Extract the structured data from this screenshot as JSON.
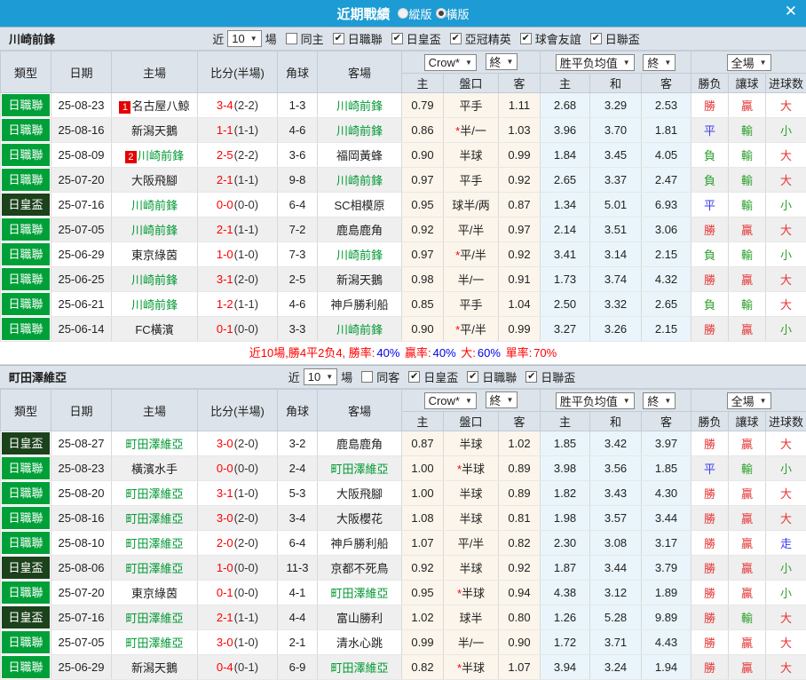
{
  "header": {
    "title": "近期戰績",
    "views": [
      {
        "label": "縱版",
        "selected": false
      },
      {
        "label": "橫版",
        "selected": true
      }
    ]
  },
  "icons": {
    "chevron": "▼",
    "check": "✔",
    "close": "✕"
  },
  "columns": {
    "type": "類型",
    "date": "日期",
    "home": "主場",
    "score": "比分(半場)",
    "corner": "角球",
    "away": "客場",
    "odds_select": "Crow*",
    "odds_final": "終",
    "odds_sub": [
      "主",
      "盤口",
      "客"
    ],
    "avg_select": "胜平负均值",
    "avg_final": "終",
    "avg_sub": [
      "主",
      "和",
      "客"
    ],
    "full_select": "全場",
    "full_sub": [
      "勝负",
      "讓球",
      "进球数"
    ]
  },
  "colors": {
    "topbar": "#1D9BD4",
    "type_badge": {
      "日職聯": "#00A039",
      "日皇盃": "#1C421C"
    },
    "focus_team": "#009933",
    "score_ft": "#FF0000",
    "summary_red": "#FF0000",
    "summary_blue": "#0000EE",
    "result": {
      "勝": "#E53535",
      "贏": "#E53535",
      "大": "#E53535",
      "平": "#3B3BF0",
      "走": "#3B3BF0",
      "負": "#2DA02D",
      "輸": "#2DA02D",
      "小": "#2DA02D"
    }
  },
  "sections": [
    {
      "team": "川崎前鋒",
      "filter": {
        "near": "近",
        "games": "10",
        "unit": "場",
        "options": [
          {
            "label": "同主",
            "checked": false
          },
          {
            "label": "日職聯",
            "checked": true
          },
          {
            "label": "日皇盃",
            "checked": true
          },
          {
            "label": "亞冠精英",
            "checked": true
          },
          {
            "label": "球會友誼",
            "checked": true
          },
          {
            "label": "日聯盃",
            "checked": true
          }
        ]
      },
      "rows": [
        {
          "type": "日職聯",
          "date": "25-08-23",
          "home": "名古屋八鯨",
          "home_badge": "1",
          "home_focus": false,
          "ft": "3-4",
          "ht": "(2-2)",
          "corner": "1-3",
          "away": "川崎前鋒",
          "away_focus": true,
          "odds": [
            "0.79",
            "平手",
            "1.11"
          ],
          "avg": [
            "2.68",
            "3.29",
            "2.53"
          ],
          "full": [
            "勝",
            "贏",
            "大"
          ]
        },
        {
          "type": "日職聯",
          "date": "25-08-16",
          "home": "新潟天鵝",
          "home_focus": false,
          "ft": "1-1",
          "ht": "(1-1)",
          "corner": "4-6",
          "away": "川崎前鋒",
          "away_focus": true,
          "odds": [
            "0.86",
            "*半/一",
            "1.03"
          ],
          "avg": [
            "3.96",
            "3.70",
            "1.81"
          ],
          "full": [
            "平",
            "輸",
            "小"
          ]
        },
        {
          "type": "日職聯",
          "date": "25-08-09",
          "home": "川崎前鋒",
          "home_badge": "2",
          "home_focus": true,
          "ft": "2-5",
          "ht": "(2-2)",
          "corner": "3-6",
          "away": "福岡黃蜂",
          "away_focus": false,
          "odds": [
            "0.90",
            "半球",
            "0.99"
          ],
          "avg": [
            "1.84",
            "3.45",
            "4.05"
          ],
          "full": [
            "負",
            "輸",
            "大"
          ]
        },
        {
          "type": "日職聯",
          "date": "25-07-20",
          "home": "大阪飛腳",
          "home_focus": false,
          "ft": "2-1",
          "ht": "(1-1)",
          "corner": "9-8",
          "away": "川崎前鋒",
          "away_focus": true,
          "odds": [
            "0.97",
            "平手",
            "0.92"
          ],
          "avg": [
            "2.65",
            "3.37",
            "2.47"
          ],
          "full": [
            "負",
            "輸",
            "大"
          ]
        },
        {
          "type": "日皇盃",
          "date": "25-07-16",
          "home": "川崎前鋒",
          "home_focus": true,
          "ft": "0-0",
          "ht": "(0-0)",
          "corner": "6-4",
          "away": "SC相模原",
          "away_focus": false,
          "odds": [
            "0.95",
            "球半/两",
            "0.87"
          ],
          "avg": [
            "1.34",
            "5.01",
            "6.93"
          ],
          "full": [
            "平",
            "輸",
            "小"
          ]
        },
        {
          "type": "日職聯",
          "date": "25-07-05",
          "home": "川崎前鋒",
          "home_focus": true,
          "ft": "2-1",
          "ht": "(1-1)",
          "corner": "7-2",
          "away": "鹿島鹿角",
          "away_focus": false,
          "odds": [
            "0.92",
            "平/半",
            "0.97"
          ],
          "avg": [
            "2.14",
            "3.51",
            "3.06"
          ],
          "full": [
            "勝",
            "贏",
            "大"
          ]
        },
        {
          "type": "日職聯",
          "date": "25-06-29",
          "home": "東京綠茵",
          "home_focus": false,
          "ft": "1-0",
          "ht": "(1-0)",
          "corner": "7-3",
          "away": "川崎前鋒",
          "away_focus": true,
          "odds": [
            "0.97",
            "*平/半",
            "0.92"
          ],
          "avg": [
            "3.41",
            "3.14",
            "2.15"
          ],
          "full": [
            "負",
            "輸",
            "小"
          ]
        },
        {
          "type": "日職聯",
          "date": "25-06-25",
          "home": "川崎前鋒",
          "home_focus": true,
          "ft": "3-1",
          "ht": "(2-0)",
          "corner": "2-5",
          "away": "新潟天鵝",
          "away_focus": false,
          "odds": [
            "0.98",
            "半/一",
            "0.91"
          ],
          "avg": [
            "1.73",
            "3.74",
            "4.32"
          ],
          "full": [
            "勝",
            "贏",
            "大"
          ]
        },
        {
          "type": "日職聯",
          "date": "25-06-21",
          "home": "川崎前鋒",
          "home_focus": true,
          "ft": "1-2",
          "ht": "(1-1)",
          "corner": "4-6",
          "away": "神戶勝利船",
          "away_focus": false,
          "odds": [
            "0.85",
            "平手",
            "1.04"
          ],
          "avg": [
            "2.50",
            "3.32",
            "2.65"
          ],
          "full": [
            "負",
            "輸",
            "大"
          ]
        },
        {
          "type": "日職聯",
          "date": "25-06-14",
          "home": "FC橫濱",
          "home_focus": false,
          "ft": "0-1",
          "ht": "(0-0)",
          "corner": "3-3",
          "away": "川崎前鋒",
          "away_focus": true,
          "odds": [
            "0.90",
            "*平/半",
            "0.99"
          ],
          "avg": [
            "3.27",
            "3.26",
            "2.15"
          ],
          "full": [
            "勝",
            "贏",
            "小"
          ]
        }
      ],
      "summary": [
        {
          "t": "近10場,勝4平2负4, 勝率:",
          "c": "red"
        },
        {
          "t": "40%",
          "c": "blue"
        },
        {
          "t": " 贏率:",
          "c": "red"
        },
        {
          "t": "40%",
          "c": "blue"
        },
        {
          "t": " 大:",
          "c": "red"
        },
        {
          "t": "60%",
          "c": "blue"
        },
        {
          "t": " 單率:",
          "c": "red"
        },
        {
          "t": "70%",
          "c": "red"
        }
      ]
    },
    {
      "team": "町田澤維亞",
      "filter": {
        "near": "近",
        "games": "10",
        "unit": "場",
        "options": [
          {
            "label": "同客",
            "checked": false
          },
          {
            "label": "日皇盃",
            "checked": true
          },
          {
            "label": "日職聯",
            "checked": true
          },
          {
            "label": "日聯盃",
            "checked": true
          }
        ]
      },
      "rows": [
        {
          "type": "日皇盃",
          "date": "25-08-27",
          "home": "町田澤維亞",
          "home_focus": true,
          "ft": "3-0",
          "ht": "(2-0)",
          "corner": "3-2",
          "away": "鹿島鹿角",
          "away_focus": false,
          "odds": [
            "0.87",
            "半球",
            "1.02"
          ],
          "avg": [
            "1.85",
            "3.42",
            "3.97"
          ],
          "full": [
            "勝",
            "贏",
            "大"
          ]
        },
        {
          "type": "日職聯",
          "date": "25-08-23",
          "home": "橫濱水手",
          "home_focus": false,
          "ft": "0-0",
          "ht": "(0-0)",
          "corner": "2-4",
          "away": "町田澤維亞",
          "away_focus": true,
          "odds": [
            "1.00",
            "*半球",
            "0.89"
          ],
          "avg": [
            "3.98",
            "3.56",
            "1.85"
          ],
          "full": [
            "平",
            "輸",
            "小"
          ]
        },
        {
          "type": "日職聯",
          "date": "25-08-20",
          "home": "町田澤維亞",
          "home_focus": true,
          "ft": "3-1",
          "ht": "(1-0)",
          "corner": "5-3",
          "away": "大阪飛腳",
          "away_focus": false,
          "odds": [
            "1.00",
            "半球",
            "0.89"
          ],
          "avg": [
            "1.82",
            "3.43",
            "4.30"
          ],
          "full": [
            "勝",
            "贏",
            "大"
          ]
        },
        {
          "type": "日職聯",
          "date": "25-08-16",
          "home": "町田澤維亞",
          "home_focus": true,
          "ft": "3-0",
          "ht": "(2-0)",
          "corner": "3-4",
          "away": "大阪櫻花",
          "away_focus": false,
          "odds": [
            "1.08",
            "半球",
            "0.81"
          ],
          "avg": [
            "1.98",
            "3.57",
            "3.44"
          ],
          "full": [
            "勝",
            "贏",
            "大"
          ]
        },
        {
          "type": "日職聯",
          "date": "25-08-10",
          "home": "町田澤維亞",
          "home_focus": true,
          "ft": "2-0",
          "ht": "(2-0)",
          "corner": "6-4",
          "away": "神戶勝利船",
          "away_focus": false,
          "odds": [
            "1.07",
            "平/半",
            "0.82"
          ],
          "avg": [
            "2.30",
            "3.08",
            "3.17"
          ],
          "full": [
            "勝",
            "贏",
            "走"
          ]
        },
        {
          "type": "日皇盃",
          "date": "25-08-06",
          "home": "町田澤維亞",
          "home_focus": true,
          "ft": "1-0",
          "ht": "(0-0)",
          "corner": "11-3",
          "away": "京都不死鳥",
          "away_focus": false,
          "odds": [
            "0.92",
            "半球",
            "0.92"
          ],
          "avg": [
            "1.87",
            "3.44",
            "3.79"
          ],
          "full": [
            "勝",
            "贏",
            "小"
          ]
        },
        {
          "type": "日職聯",
          "date": "25-07-20",
          "home": "東京綠茵",
          "home_focus": false,
          "ft": "0-1",
          "ht": "(0-0)",
          "corner": "4-1",
          "away": "町田澤維亞",
          "away_focus": true,
          "odds": [
            "0.95",
            "*半球",
            "0.94"
          ],
          "avg": [
            "4.38",
            "3.12",
            "1.89"
          ],
          "full": [
            "勝",
            "贏",
            "小"
          ]
        },
        {
          "type": "日皇盃",
          "date": "25-07-16",
          "home": "町田澤維亞",
          "home_focus": true,
          "ft": "2-1",
          "ht": "(1-1)",
          "corner": "4-4",
          "away": "富山勝利",
          "away_focus": false,
          "odds": [
            "1.02",
            "球半",
            "0.80"
          ],
          "avg": [
            "1.26",
            "5.28",
            "9.89"
          ],
          "full": [
            "勝",
            "輸",
            "大"
          ]
        },
        {
          "type": "日職聯",
          "date": "25-07-05",
          "home": "町田澤維亞",
          "home_focus": true,
          "ft": "3-0",
          "ht": "(1-0)",
          "corner": "2-1",
          "away": "清水心跳",
          "away_focus": false,
          "odds": [
            "0.99",
            "半/一",
            "0.90"
          ],
          "avg": [
            "1.72",
            "3.71",
            "4.43"
          ],
          "full": [
            "勝",
            "贏",
            "大"
          ]
        },
        {
          "type": "日職聯",
          "date": "25-06-29",
          "home": "新潟天鵝",
          "home_focus": false,
          "ft": "0-4",
          "ht": "(0-1)",
          "corner": "6-9",
          "away": "町田澤維亞",
          "away_focus": true,
          "odds": [
            "0.82",
            "*半球",
            "1.07"
          ],
          "avg": [
            "3.94",
            "3.24",
            "1.94"
          ],
          "full": [
            "勝",
            "贏",
            "大"
          ]
        }
      ]
    }
  ]
}
